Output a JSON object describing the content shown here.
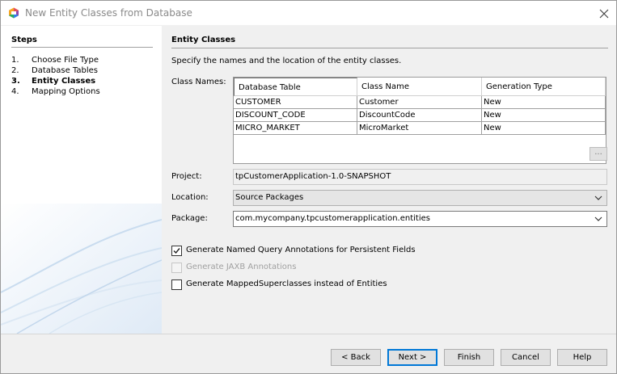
{
  "window": {
    "title": "New Entity Classes from Database",
    "icon": "netbeans-icon",
    "close_icon": "close-icon"
  },
  "steps": {
    "header": "Steps",
    "items": [
      {
        "num": "1.",
        "label": "Choose File Type"
      },
      {
        "num": "2.",
        "label": "Database Tables"
      },
      {
        "num": "3.",
        "label": "Entity Classes"
      },
      {
        "num": "4.",
        "label": "Mapping Options"
      }
    ],
    "current_index": 2
  },
  "content": {
    "title": "Entity Classes",
    "description": "Specify the names and the location of the entity classes.",
    "class_names_label": "Class Names:",
    "table": {
      "columns": [
        "Database Table",
        "Class Name",
        "Generation Type"
      ],
      "rows": [
        [
          "CUSTOMER",
          "Customer",
          "New"
        ],
        [
          "DISCOUNT_CODE",
          "DiscountCode",
          "New"
        ],
        [
          "MICRO_MARKET",
          "MicroMarket",
          "New"
        ]
      ]
    },
    "ellipsis_button": "...",
    "project_label": "Project:",
    "project_value": "tpCustomerApplication-1.0-SNAPSHOT",
    "location_label": "Location:",
    "location_value": "Source Packages",
    "package_label": "Package:",
    "package_value": "com.mycompany.tpcustomerapplication.entities",
    "checkboxes": [
      {
        "label": "Generate Named Query Annotations for Persistent Fields",
        "checked": true,
        "enabled": true
      },
      {
        "label": "Generate JAXB Annotations",
        "checked": false,
        "enabled": false
      },
      {
        "label": "Generate MappedSuperclasses instead of Entities",
        "checked": false,
        "enabled": true
      }
    ]
  },
  "buttons": {
    "back": "< Back",
    "next": "Next >",
    "finish": "Finish",
    "cancel": "Cancel",
    "help": "Help"
  },
  "colors": {
    "accent": "#0078d7",
    "panel": "#f0f0f0",
    "art_line": "#c9dcef"
  }
}
